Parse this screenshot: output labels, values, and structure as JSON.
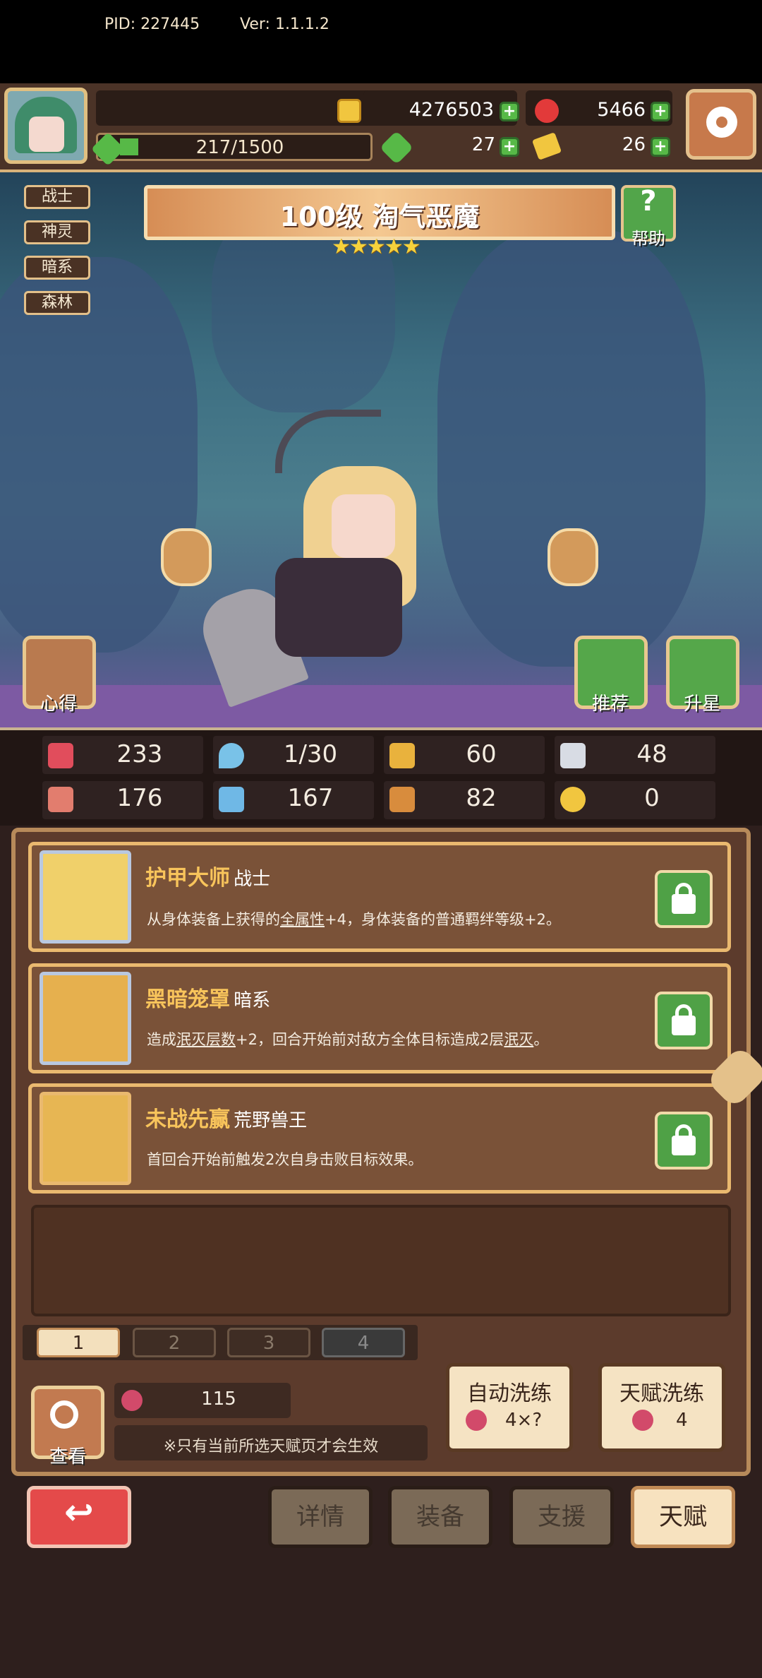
{
  "header": {
    "pid": "PID: 227445",
    "version": "Ver: 1.1.1.2",
    "gold": "4276503",
    "gems": "5466",
    "exp": "217/1500",
    "clover": "27",
    "tickets": "26"
  },
  "hero": {
    "tags": [
      "战士",
      "神灵",
      "暗系",
      "森林"
    ],
    "title": "100级 淘气恶魔",
    "stars": "★★★★★",
    "help_label": "帮助",
    "help_symbol": "?",
    "xinde_label": "心得",
    "tuijian_label": "推荐",
    "shengxing_label": "升星"
  },
  "stats": {
    "hp": "233",
    "mana": "1/30",
    "defense": "60",
    "speed": "48",
    "attack": "176",
    "magic": "167",
    "crit": "82",
    "dodge": "0"
  },
  "talents": [
    {
      "name": "护甲大师",
      "tag": "战士",
      "desc_pre": "从身体装备上获得的",
      "desc_link": "全属性",
      "desc_post": "+4，身体装备的普通羁绊等级+2。"
    },
    {
      "name": "黑暗笼罩",
      "tag": "暗系",
      "desc_pre": "造成",
      "desc_link": "泯灭层数",
      "desc_mid": "+2，回合开始前对敌方全体目标造成2层",
      "desc_link2": "泯灭",
      "desc_post": "。"
    },
    {
      "name": "未战先赢",
      "tag": "荒野兽王",
      "desc_pre": "首回合开始前触发2次自身击败目标效果。"
    }
  ],
  "pages": [
    "1",
    "2",
    "3",
    "4"
  ],
  "bottom": {
    "view_label": "查看",
    "fruit_count": "115",
    "note": "※只有当前所选天赋页才会生效",
    "auto_wash_label": "自动洗练",
    "auto_wash_cost": "4×?",
    "talent_wash_label": "天赋洗练",
    "talent_wash_cost": "4"
  },
  "nav": {
    "back": "↩",
    "details": "详情",
    "equip": "装备",
    "support": "支援",
    "talent": "天赋"
  }
}
